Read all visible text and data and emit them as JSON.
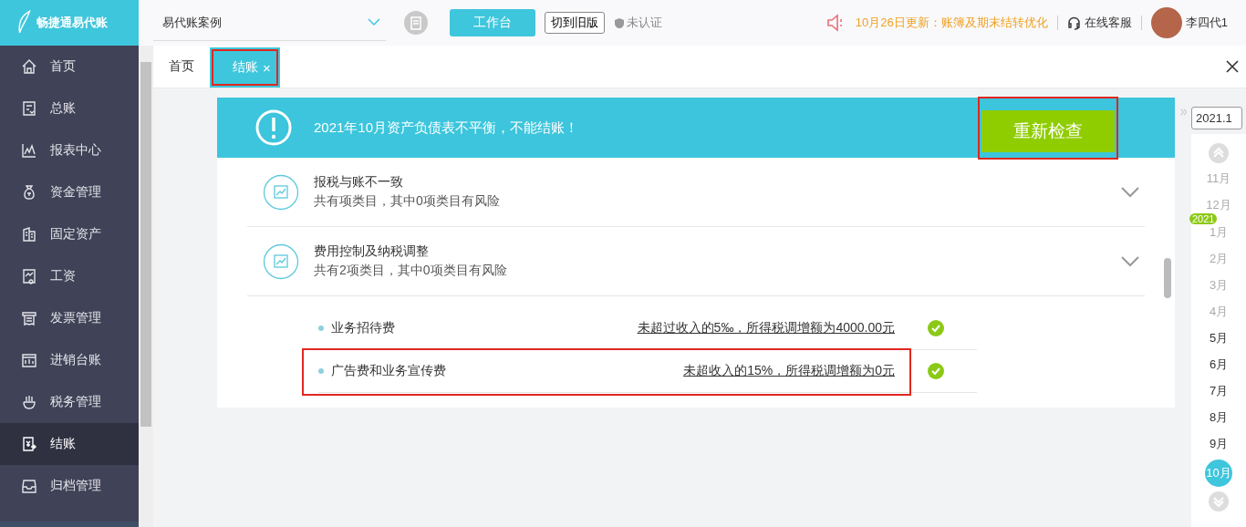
{
  "app": {
    "logo_text": "畅捷通易代账",
    "company": "易代账案例",
    "workbench_button": "工作台",
    "switch_button": "切到旧版",
    "verify_status": "未认证",
    "notice": "10月26日更新：账簿及期末结转优化",
    "support": "在线客服",
    "user_name": "李四代1"
  },
  "sidebar": {
    "items": [
      {
        "label": "首页",
        "selected": false
      },
      {
        "label": "总账",
        "selected": false
      },
      {
        "label": "报表中心",
        "selected": false
      },
      {
        "label": "资金管理",
        "selected": false
      },
      {
        "label": "固定资产",
        "selected": false
      },
      {
        "label": "工资",
        "selected": false
      },
      {
        "label": "发票管理",
        "selected": false
      },
      {
        "label": "进销台账",
        "selected": false
      },
      {
        "label": "税务管理",
        "selected": false
      },
      {
        "label": "结账",
        "selected": true
      },
      {
        "label": "归档管理",
        "selected": false
      }
    ]
  },
  "tabs": [
    {
      "label": "首页",
      "selected": false,
      "closable": false
    },
    {
      "label": "结账",
      "selected": true,
      "closable": true
    }
  ],
  "tab_close": "×",
  "banner": {
    "message": "2021年10月资产负债表不平衡，不能结账！",
    "button": "重新检查"
  },
  "sections": [
    {
      "title": "报税与账不一致",
      "summary": "共有项类目，其中0项类目有风险"
    },
    {
      "title": "费用控制及纳税调整",
      "summary": "共有2项类目，其中0项类目有风险",
      "children": [
        {
          "name": "业务招待费",
          "result": "未超过收入的5‰，所得税调增额为4000.00元",
          "passed": true
        },
        {
          "name": "广告费和业务宣传费",
          "result": "未超收入的15%，所得税调增额为0元",
          "passed": true
        }
      ]
    }
  ],
  "calendar": {
    "date_field": "2021.1",
    "year": "2021",
    "months": [
      {
        "label": "11月",
        "disabled": true,
        "selected": false
      },
      {
        "label": "12月",
        "disabled": true,
        "selected": false
      },
      {
        "label": "1月",
        "disabled": true,
        "selected": false
      },
      {
        "label": "2月",
        "disabled": true,
        "selected": false
      },
      {
        "label": "3月",
        "disabled": true,
        "selected": false
      },
      {
        "label": "4月",
        "disabled": true,
        "selected": false
      },
      {
        "label": "5月",
        "disabled": false,
        "selected": false
      },
      {
        "label": "6月",
        "disabled": false,
        "selected": false
      },
      {
        "label": "7月",
        "disabled": false,
        "selected": false
      },
      {
        "label": "8月",
        "disabled": false,
        "selected": false
      },
      {
        "label": "9月",
        "disabled": false,
        "selected": false
      },
      {
        "label": "10月",
        "disabled": false,
        "selected": true
      }
    ]
  }
}
